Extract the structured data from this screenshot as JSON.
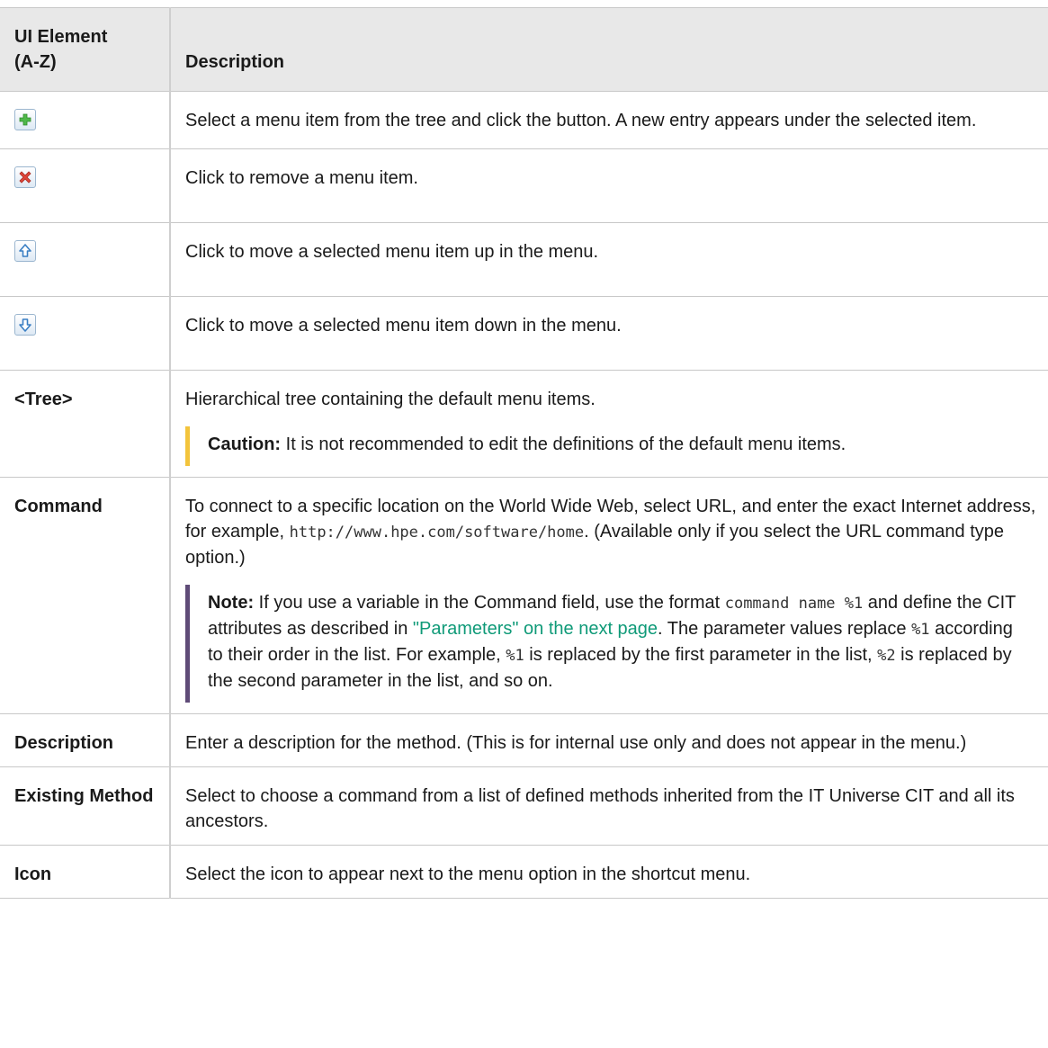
{
  "table": {
    "header": {
      "col1_line1": "UI Element",
      "col1_line2": "(A-Z)",
      "col2": "Description"
    },
    "rows": {
      "add": {
        "icon": "add-plus-icon",
        "description": "Select a menu item from the tree and click the button. A new entry appears under the selected item."
      },
      "remove": {
        "icon": "remove-x-icon",
        "description": "Click to remove a menu item."
      },
      "up": {
        "icon": "move-up-arrow-icon",
        "description": "Click to move a selected menu item up in the menu."
      },
      "down": {
        "icon": "move-down-arrow-icon",
        "description": "Click to move a selected menu item down in the menu."
      },
      "tree": {
        "element": "<Tree>",
        "description": "Hierarchical tree containing the default menu items.",
        "caution_label": "Caution:",
        "caution_text": "It is not recommended to edit the definitions of the default menu items."
      },
      "command": {
        "element": "Command",
        "description_part1": "To connect to a specific location on the World Wide Web, select URL, and enter the exact Internet address, for example, ",
        "description_code": "http://www.hpe.com/software/home",
        "description_part2": ". (Available only if you select the URL command type option.)",
        "note_label": "Note:",
        "note_text1": "If you use a variable in the Command field, use the format ",
        "note_code1": "command name %1",
        "note_text2": " and define the CIT attributes as described in ",
        "note_link": "\"Parameters\" on the next page",
        "note_text3": ". The parameter values replace ",
        "note_code2": "%1",
        "note_text4": " according to their order in the list. For example, ",
        "note_code3": "%1",
        "note_text5": " is replaced by the first parameter in the list, ",
        "note_code4": "%2",
        "note_text6": " is replaced by the second parameter in the list, and so on."
      },
      "description": {
        "element": "Description",
        "description": "Enter a description for the method. (This is for internal use only and does not appear in the menu.)"
      },
      "existing_method": {
        "element": "Existing Method",
        "description": "Select to choose a command from a list of defined methods inherited from the IT Universe CIT and all its ancestors."
      },
      "icon": {
        "element": "Icon",
        "description": "Select the icon to appear next to the menu option in the shortcut menu."
      }
    }
  }
}
